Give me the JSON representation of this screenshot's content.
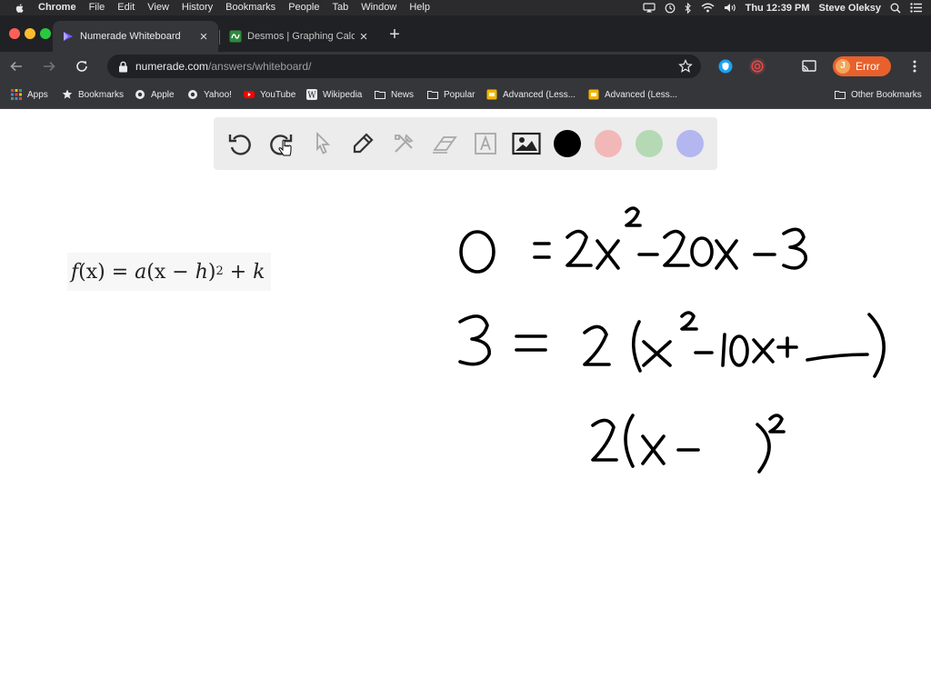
{
  "menubar": {
    "app": "Chrome",
    "items": [
      "File",
      "Edit",
      "View",
      "History",
      "Bookmarks",
      "People",
      "Tab",
      "Window",
      "Help"
    ],
    "clock": "Thu 12:39 PM",
    "user": "Steve Oleksy"
  },
  "tabs": [
    {
      "title": "Numerade Whiteboard",
      "active": true
    },
    {
      "title": "Desmos | Graphing Calculator",
      "active": false
    }
  ],
  "omnibox": {
    "host": "numerade.com",
    "path": "/answers/whiteboard/"
  },
  "profile": {
    "initial": "J",
    "status": "Error",
    "color": "#e8612c"
  },
  "bookmarks": [
    {
      "label": "Apps",
      "icon": "apps-grid-icon"
    },
    {
      "label": "Bookmarks",
      "icon": "star-icon"
    },
    {
      "label": "Apple",
      "icon": "globe-icon"
    },
    {
      "label": "Yahoo!",
      "icon": "globe-icon"
    },
    {
      "label": "YouTube",
      "icon": "youtube-icon"
    },
    {
      "label": "Wikipedia",
      "icon": "wikipedia-icon"
    },
    {
      "label": "News",
      "icon": "folder-icon"
    },
    {
      "label": "Popular",
      "icon": "folder-icon"
    },
    {
      "label": "Advanced (Less...",
      "icon": "slides-icon"
    },
    {
      "label": "Advanced (Less...",
      "icon": "slides-icon"
    }
  ],
  "other_bookmarks": "Other Bookmarks",
  "whiteboard": {
    "tools": [
      "undo-icon",
      "redo-icon",
      "select-arrow-icon",
      "pen-icon",
      "tools-icon",
      "eraser-icon",
      "text-icon",
      "image-icon"
    ],
    "colors": [
      "#000000",
      "#f2b8b8",
      "#b5d9b5",
      "#b3b6ef"
    ],
    "formula": {
      "lhs": "f",
      "arg": "(x)",
      "eq": " = ",
      "a": "a",
      "paren_open": "(x − ",
      "h": "h",
      "paren_close": ")",
      "exp": "2",
      "plus": " + ",
      "k": "k"
    }
  }
}
